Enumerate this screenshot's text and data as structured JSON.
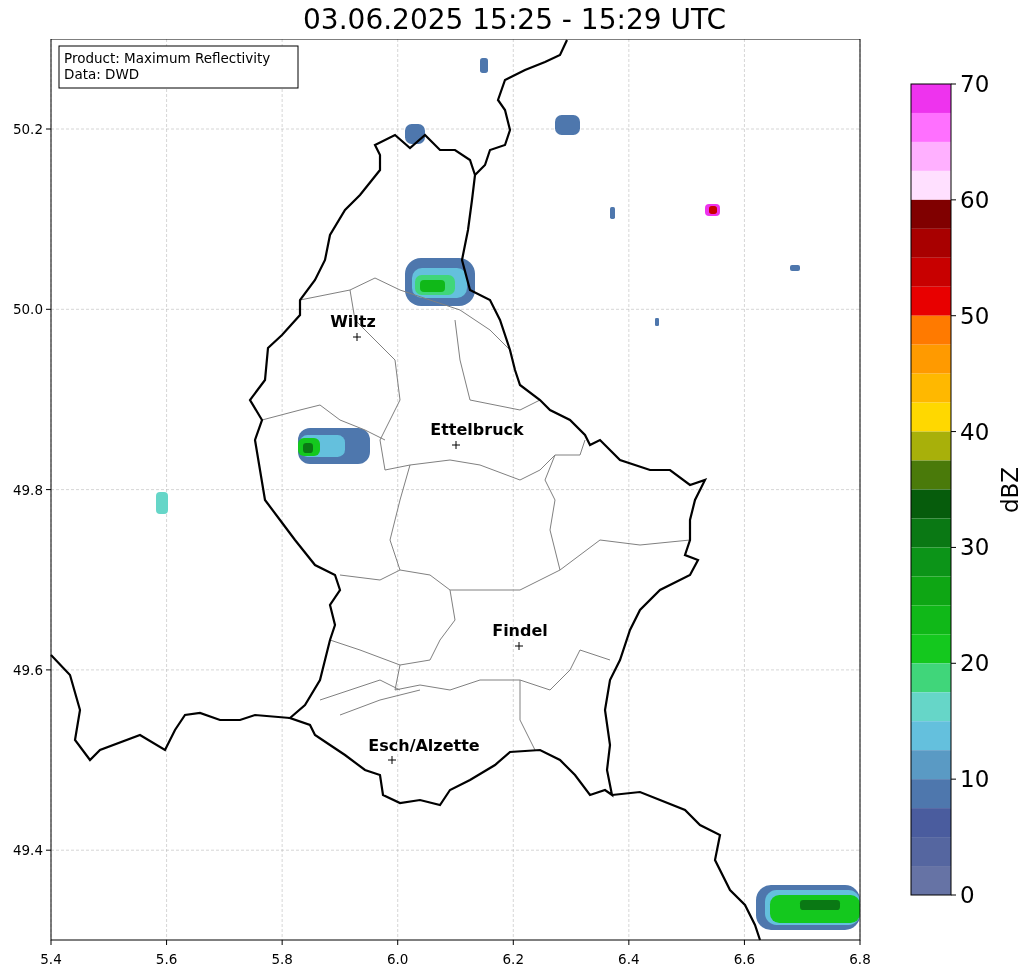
{
  "title": "03.06.2025 15:25 - 15:29 UTC",
  "map": {
    "info_box": [
      "Product: Maximum Reflectivity",
      "Data: DWD"
    ],
    "cities": [
      {
        "name": "Wiltz"
      },
      {
        "name": "Ettelbruck"
      },
      {
        "name": "Findel"
      },
      {
        "name": "Esch/Alzette"
      }
    ],
    "xticks": [
      "5.4",
      "5.6",
      "5.8",
      "6.0",
      "6.2",
      "6.4",
      "6.6",
      "6.8"
    ],
    "yticks": [
      "50.2",
      "50.0",
      "49.8",
      "49.6",
      "49.4"
    ]
  },
  "colorbar": {
    "label": "dBZ",
    "ticks": [
      "70",
      "60",
      "50",
      "40",
      "30",
      "20",
      "10",
      "0"
    ],
    "segments": [
      {
        "color": "#ee33ee"
      },
      {
        "color": "#ff70ff"
      },
      {
        "color": "#ffb0ff"
      },
      {
        "color": "#ffe0ff"
      },
      {
        "color": "#800000"
      },
      {
        "color": "#a80000"
      },
      {
        "color": "#c80000"
      },
      {
        "color": "#e80000"
      },
      {
        "color": "#ff7a00"
      },
      {
        "color": "#ff9a00"
      },
      {
        "color": "#ffb800"
      },
      {
        "color": "#ffd800"
      },
      {
        "color": "#a8b00a"
      },
      {
        "color": "#4a7a0a"
      },
      {
        "color": "#065c0c"
      },
      {
        "color": "#0a7814"
      },
      {
        "color": "#0c9418"
      },
      {
        "color": "#0ea614"
      },
      {
        "color": "#10b818"
      },
      {
        "color": "#14c81e"
      },
      {
        "color": "#40d67a"
      },
      {
        "color": "#66d6c8"
      },
      {
        "color": "#64c0dd"
      },
      {
        "color": "#5a9ac4"
      },
      {
        "color": "#4e77ad"
      },
      {
        "color": "#4a5c9e"
      },
      {
        "color": "#5566a0"
      },
      {
        "color": "#6673a5"
      }
    ]
  }
}
